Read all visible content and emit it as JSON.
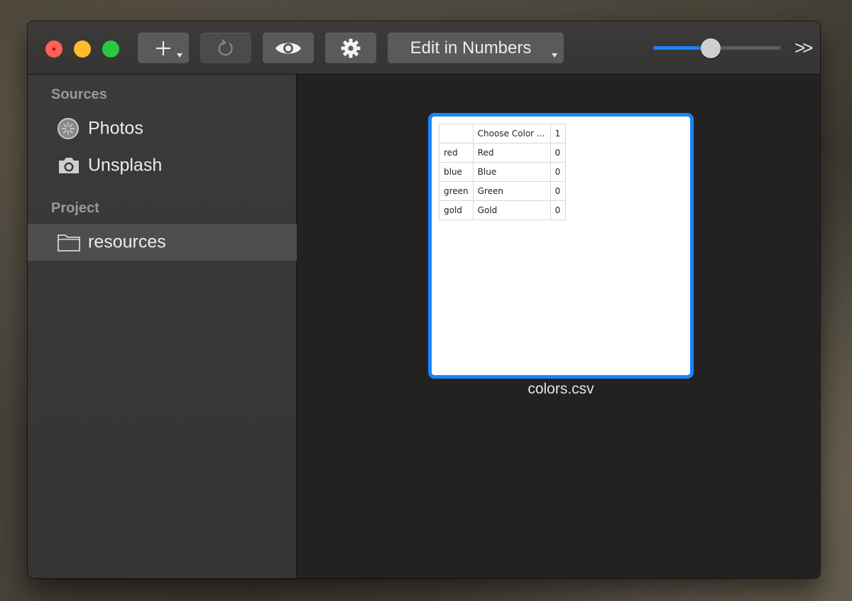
{
  "toolbar": {
    "edit_label": "Edit in Numbers",
    "overflow_label": ">>",
    "zoom_slider_value": 0.45,
    "accent_color": "#1a84ff"
  },
  "sidebar": {
    "sources_title": "Sources",
    "sources": [
      {
        "label": "Photos",
        "icon": "photos-icon"
      },
      {
        "label": "Unsplash",
        "icon": "camera-icon"
      }
    ],
    "project_title": "Project",
    "project": [
      {
        "label": "resources",
        "icon": "folder-icon",
        "selected": true
      }
    ]
  },
  "content": {
    "file_name": "colors.csv",
    "preview_rows": [
      [
        "",
        "Choose Color ...",
        "1"
      ],
      [
        "red",
        "Red",
        "0"
      ],
      [
        "blue",
        "Blue",
        "0"
      ],
      [
        "green",
        "Green",
        "0"
      ],
      [
        "gold",
        "Gold",
        "0"
      ]
    ]
  }
}
